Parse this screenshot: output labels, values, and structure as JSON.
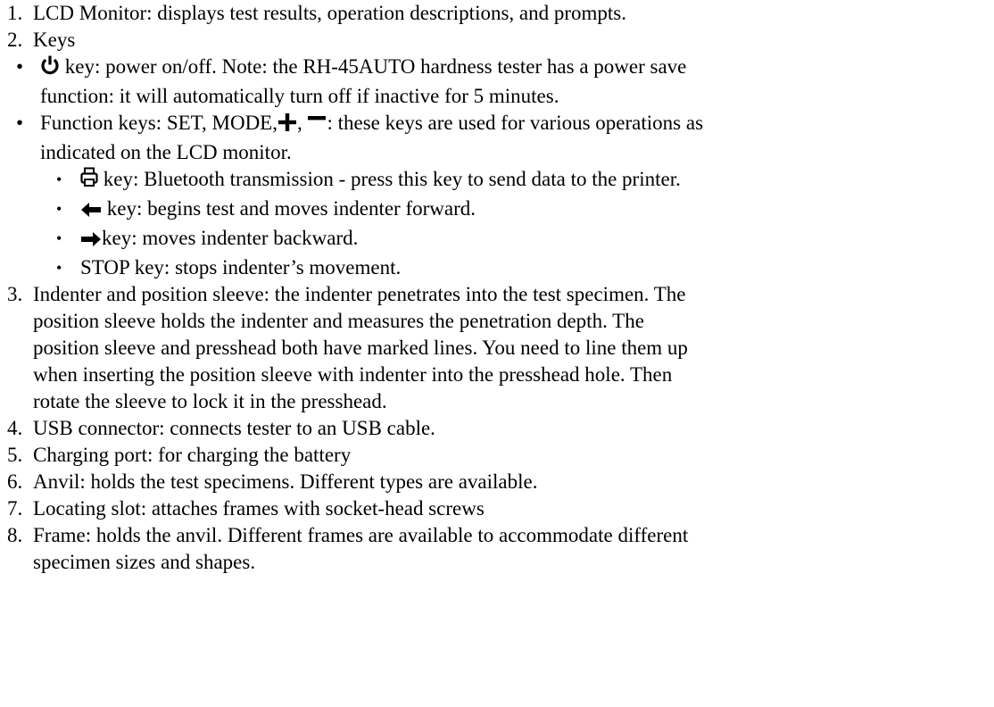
{
  "items": [
    {
      "n": "1.",
      "lines": [
        "LCD Monitor: displays test results, operation descriptions, and prompts."
      ]
    },
    {
      "n": "2.",
      "lines": [
        "Keys"
      ]
    },
    {
      "b": "•",
      "power_rest_1": " key: power on/off. Note: the RH-45AUTO hardness tester has a power save",
      "lines_after": [
        "function: it will automatically turn off if inactive for 5 minutes."
      ]
    },
    {
      "b": "•",
      "func_a": "Function keys: SET, MODE,",
      "func_b": ", ",
      "func_c": ": these keys are used for various operations as",
      "lines_after": [
        "indicated on the LCD monitor."
      ]
    },
    {
      "b": "•",
      "print_rest": " key: Bluetooth transmission - press this key to send data to the printer."
    },
    {
      "b": "•",
      "left_rest": " key: begins test and moves indenter forward."
    },
    {
      "b": "•",
      "right_rest": "key: moves indenter backward."
    },
    {
      "b": "•",
      "stop": "STOP key: stops indenter’s movement."
    },
    {
      "n": "3.",
      "lines": [
        "Indenter and position sleeve: the indenter penetrates into the test specimen. The",
        "position sleeve holds the indenter and measures the penetration depth. The",
        "position sleeve and presshead both have marked lines. You need to line them up",
        "when inserting the position sleeve with indenter into the presshead hole. Then",
        "rotate the sleeve to lock it in the presshead."
      ]
    },
    {
      "n": "4.",
      "lines": [
        "USB connector: connects tester to an USB cable."
      ]
    },
    {
      "n": "5.",
      "lines": [
        "Charging port: for charging the battery"
      ]
    },
    {
      "n": "6.",
      "lines": [
        "Anvil: holds the test specimens. Different types are available."
      ]
    },
    {
      "n": "7.",
      "lines": [
        "Locating slot: attaches frames with socket-head screws"
      ]
    },
    {
      "n": "8.",
      "lines": [
        "Frame: holds the anvil. Different frames are available to accommodate different",
        "specimen sizes and shapes."
      ]
    }
  ],
  "icons": {
    "power": "power-icon",
    "plus": "plus-icon",
    "minus": "minus-icon",
    "printer": "printer-icon",
    "left": "left-arrow-icon",
    "right": "right-arrow-icon"
  }
}
